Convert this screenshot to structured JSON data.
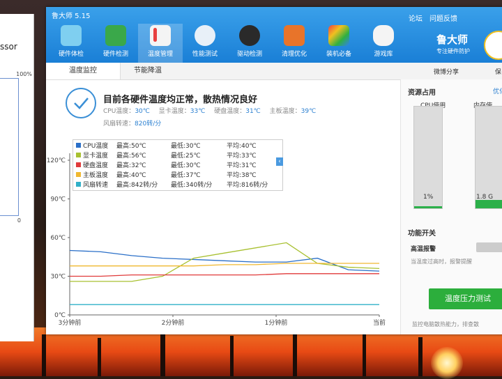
{
  "app": {
    "title": "鲁大师 5.15",
    "links": [
      "论坛",
      "问题反馈"
    ],
    "brand_name": "鲁大师",
    "brand_sub": "专注硬件防护"
  },
  "toolbar": [
    {
      "label": "硬件体检",
      "icon": "monitor-icon"
    },
    {
      "label": "硬件检测",
      "icon": "circuit-board-icon"
    },
    {
      "label": "温度管理",
      "icon": "thermometer-chart-icon",
      "active": true
    },
    {
      "label": "性能测试",
      "icon": "speedometer-icon"
    },
    {
      "label": "驱动检测",
      "icon": "gear-chip-icon"
    },
    {
      "label": "清理优化",
      "icon": "broom-icon"
    },
    {
      "label": "装机必备",
      "icon": "cube-icon"
    },
    {
      "label": "游戏库",
      "icon": "gamepad-icon"
    }
  ],
  "subtabs": [
    "温度监控",
    "节能降温"
  ],
  "share": {
    "weibo": "微博分享",
    "save": "保"
  },
  "status": {
    "title": "目前各硬件温度均正常，散热情况良好",
    "temps": [
      {
        "label": "CPU温度：",
        "value": "30℃"
      },
      {
        "label": "显卡温度：",
        "value": "33℃"
      },
      {
        "label": "硬盘温度：",
        "value": "31℃"
      },
      {
        "label": "主板温度：",
        "value": "39℃"
      }
    ],
    "fan_label": "风扇转速：",
    "fan_value": "820转/分"
  },
  "chart_data": {
    "type": "line",
    "y_ticks": [
      "120℃",
      "90℃",
      "60℃",
      "30℃",
      "0℃"
    ],
    "ylim": [
      0,
      120
    ],
    "x_labels": [
      "3分钟前",
      "2分钟前",
      "1分钟前",
      "当前"
    ],
    "x": [
      0,
      10,
      20,
      30,
      40,
      50,
      60,
      70,
      80,
      90,
      100
    ],
    "series": [
      {
        "name": "CPU温度",
        "color": "#2a6fc8",
        "max": "最高:50℃",
        "min": "最低:30℃",
        "avg": "平均:40℃",
        "values": [
          50,
          49,
          46,
          44,
          43,
          42,
          41,
          41,
          44,
          35,
          34
        ]
      },
      {
        "name": "显卡温度",
        "color": "#a8c030",
        "max": "最高:56℃",
        "min": "最低:25℃",
        "avg": "平均:33℃",
        "values": [
          26,
          26,
          26,
          30,
          44,
          48,
          52,
          56,
          40,
          37,
          36
        ]
      },
      {
        "name": "硬盘温度",
        "color": "#e03a3a",
        "max": "最高:32℃",
        "min": "最低:30℃",
        "avg": "平均:31℃",
        "values": [
          30,
          30,
          31,
          31,
          31,
          31,
          31,
          32,
          32,
          32,
          32
        ]
      },
      {
        "name": "主板温度",
        "color": "#f0b830",
        "max": "最高:40℃",
        "min": "最低:37℃",
        "avg": "平均:38℃",
        "values": [
          38,
          38,
          38,
          38,
          38,
          39,
          39,
          40,
          40,
          40,
          40
        ]
      },
      {
        "name": "风扇转速",
        "color": "#30b0c8",
        "max": "最高:842转/分",
        "min": "最低:340转/分",
        "avg": "平均:816转/分",
        "values": [
          8,
          8,
          8,
          8,
          8,
          8,
          8,
          8,
          8,
          8,
          8
        ]
      }
    ]
  },
  "resources": {
    "title": "资源占用",
    "more": "优化",
    "cpu_label": "CPU使用",
    "cpu_value": "1%",
    "cpu_fraction": 0.01,
    "mem_label": "内存使",
    "mem_value": "1.8 G",
    "mem_fraction": 0.08
  },
  "functions": {
    "title": "功能开关",
    "alarm_label": "高温报警",
    "alarm_desc": "当温度过高时，报警提醒",
    "stress_button": "温度压力测试",
    "footer": "监控电脑散热能力，排查散"
  },
  "background_window": {
    "title": "ssor",
    "percent": "100%",
    "zero": "0"
  }
}
